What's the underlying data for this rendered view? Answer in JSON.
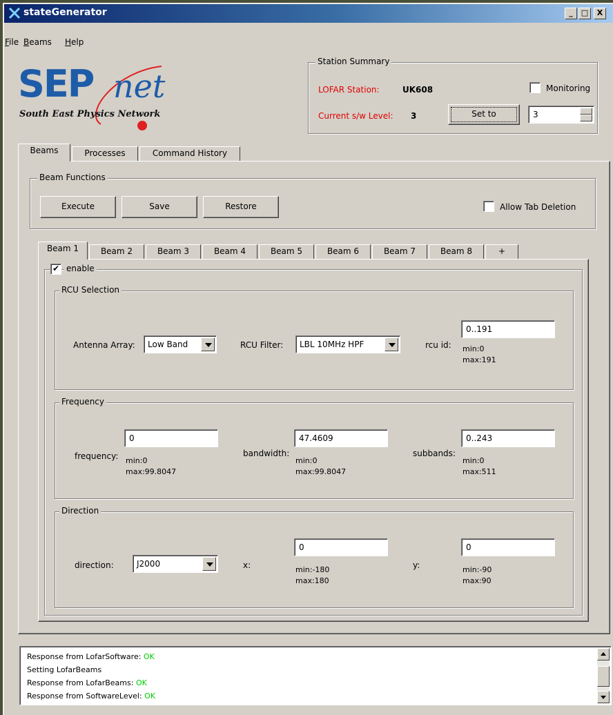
{
  "window": {
    "title": "stateGenerator",
    "minimize": "_",
    "maximize": "□",
    "close": "X"
  },
  "menu": [
    {
      "label": "File",
      "mnemonic": "F",
      "rest": "ile"
    },
    {
      "label": "Beams",
      "mnemonic": "B",
      "rest": "eams"
    },
    {
      "label": "Help",
      "mnemonic": "H",
      "rest": "elp"
    }
  ],
  "logo": {
    "sep": "SEP",
    "net": "net",
    "tagline": "South East Physics Network"
  },
  "station_summary": {
    "legend": "Station Summary",
    "station_label": "LOFAR Station:",
    "station_value": "UK608",
    "monitoring_label": "Monitoring",
    "monitoring_checked": false,
    "level_label": "Current s/w Level:",
    "level_value": "3",
    "set_to_label": "Set to",
    "spin_value": "3"
  },
  "main_tabs": [
    {
      "label": "Beams",
      "mnemonic": "",
      "active": true
    },
    {
      "label": "Processes",
      "active": false
    },
    {
      "label": "Command History",
      "active": false
    }
  ],
  "beam_functions": {
    "legend": "Beam Functions",
    "execute": "Execute",
    "save": "Save",
    "restore": "Restore",
    "allow_tab_deletion": "Allow Tab Deletion",
    "allow_tab_deletion_checked": false
  },
  "beam_tabs": [
    "Beam 1",
    "Beam 2",
    "Beam 3",
    "Beam 4",
    "Beam 5",
    "Beam 6",
    "Beam 7",
    "Beam 8",
    "+"
  ],
  "beam": {
    "enable_label": "enable",
    "enable_checked": true,
    "enable_mark": "✔",
    "rcu": {
      "legend": "RCU Selection",
      "antenna_label": "Antenna Array:",
      "antenna_value": "Low Band",
      "filter_label": "RCU Filter:",
      "filter_value": "LBL 10MHz HPF",
      "rcu_id_label": "rcu id:",
      "rcu_id_value": "0..191",
      "rcu_min": "min:0",
      "rcu_max": "max:191"
    },
    "frequency": {
      "legend": "Frequency",
      "frequency_label": "frequency:",
      "frequency_value": "0",
      "frequency_min": "min:0",
      "frequency_max": "max:99.8047",
      "bandwidth_label": "bandwidth:",
      "bandwidth_value": "47.4609",
      "bandwidth_min": "min:0",
      "bandwidth_max": "max:99.8047",
      "subbands_label": "subbands:",
      "subbands_value": "0..243",
      "subbands_min": "min:0",
      "subbands_max": "max:511"
    },
    "direction": {
      "legend": "Direction",
      "direction_label": "direction:",
      "direction_value": "J2000",
      "x_label": "x:",
      "x_value": "0",
      "x_min": "min:-180",
      "x_max": "max:180",
      "y_label": "y:",
      "y_value": "0",
      "y_min": "min:-90",
      "y_max": "max:90"
    }
  },
  "log": [
    {
      "text": "Response from LofarSoftware: ",
      "status": "OK"
    },
    {
      "text": "Setting LofarBeams",
      "status": ""
    },
    {
      "text": "Response from LofarBeams: ",
      "status": "OK"
    },
    {
      "text": "Response from SoftwareLevel: ",
      "status": "OK"
    }
  ],
  "colors": {
    "title_start": "#0a246a",
    "title_end": "#a6caf0",
    "ok": "#00cc00",
    "alert": "#e00000",
    "brand": "#1e5ca8",
    "logo_dot": "#e02020"
  }
}
